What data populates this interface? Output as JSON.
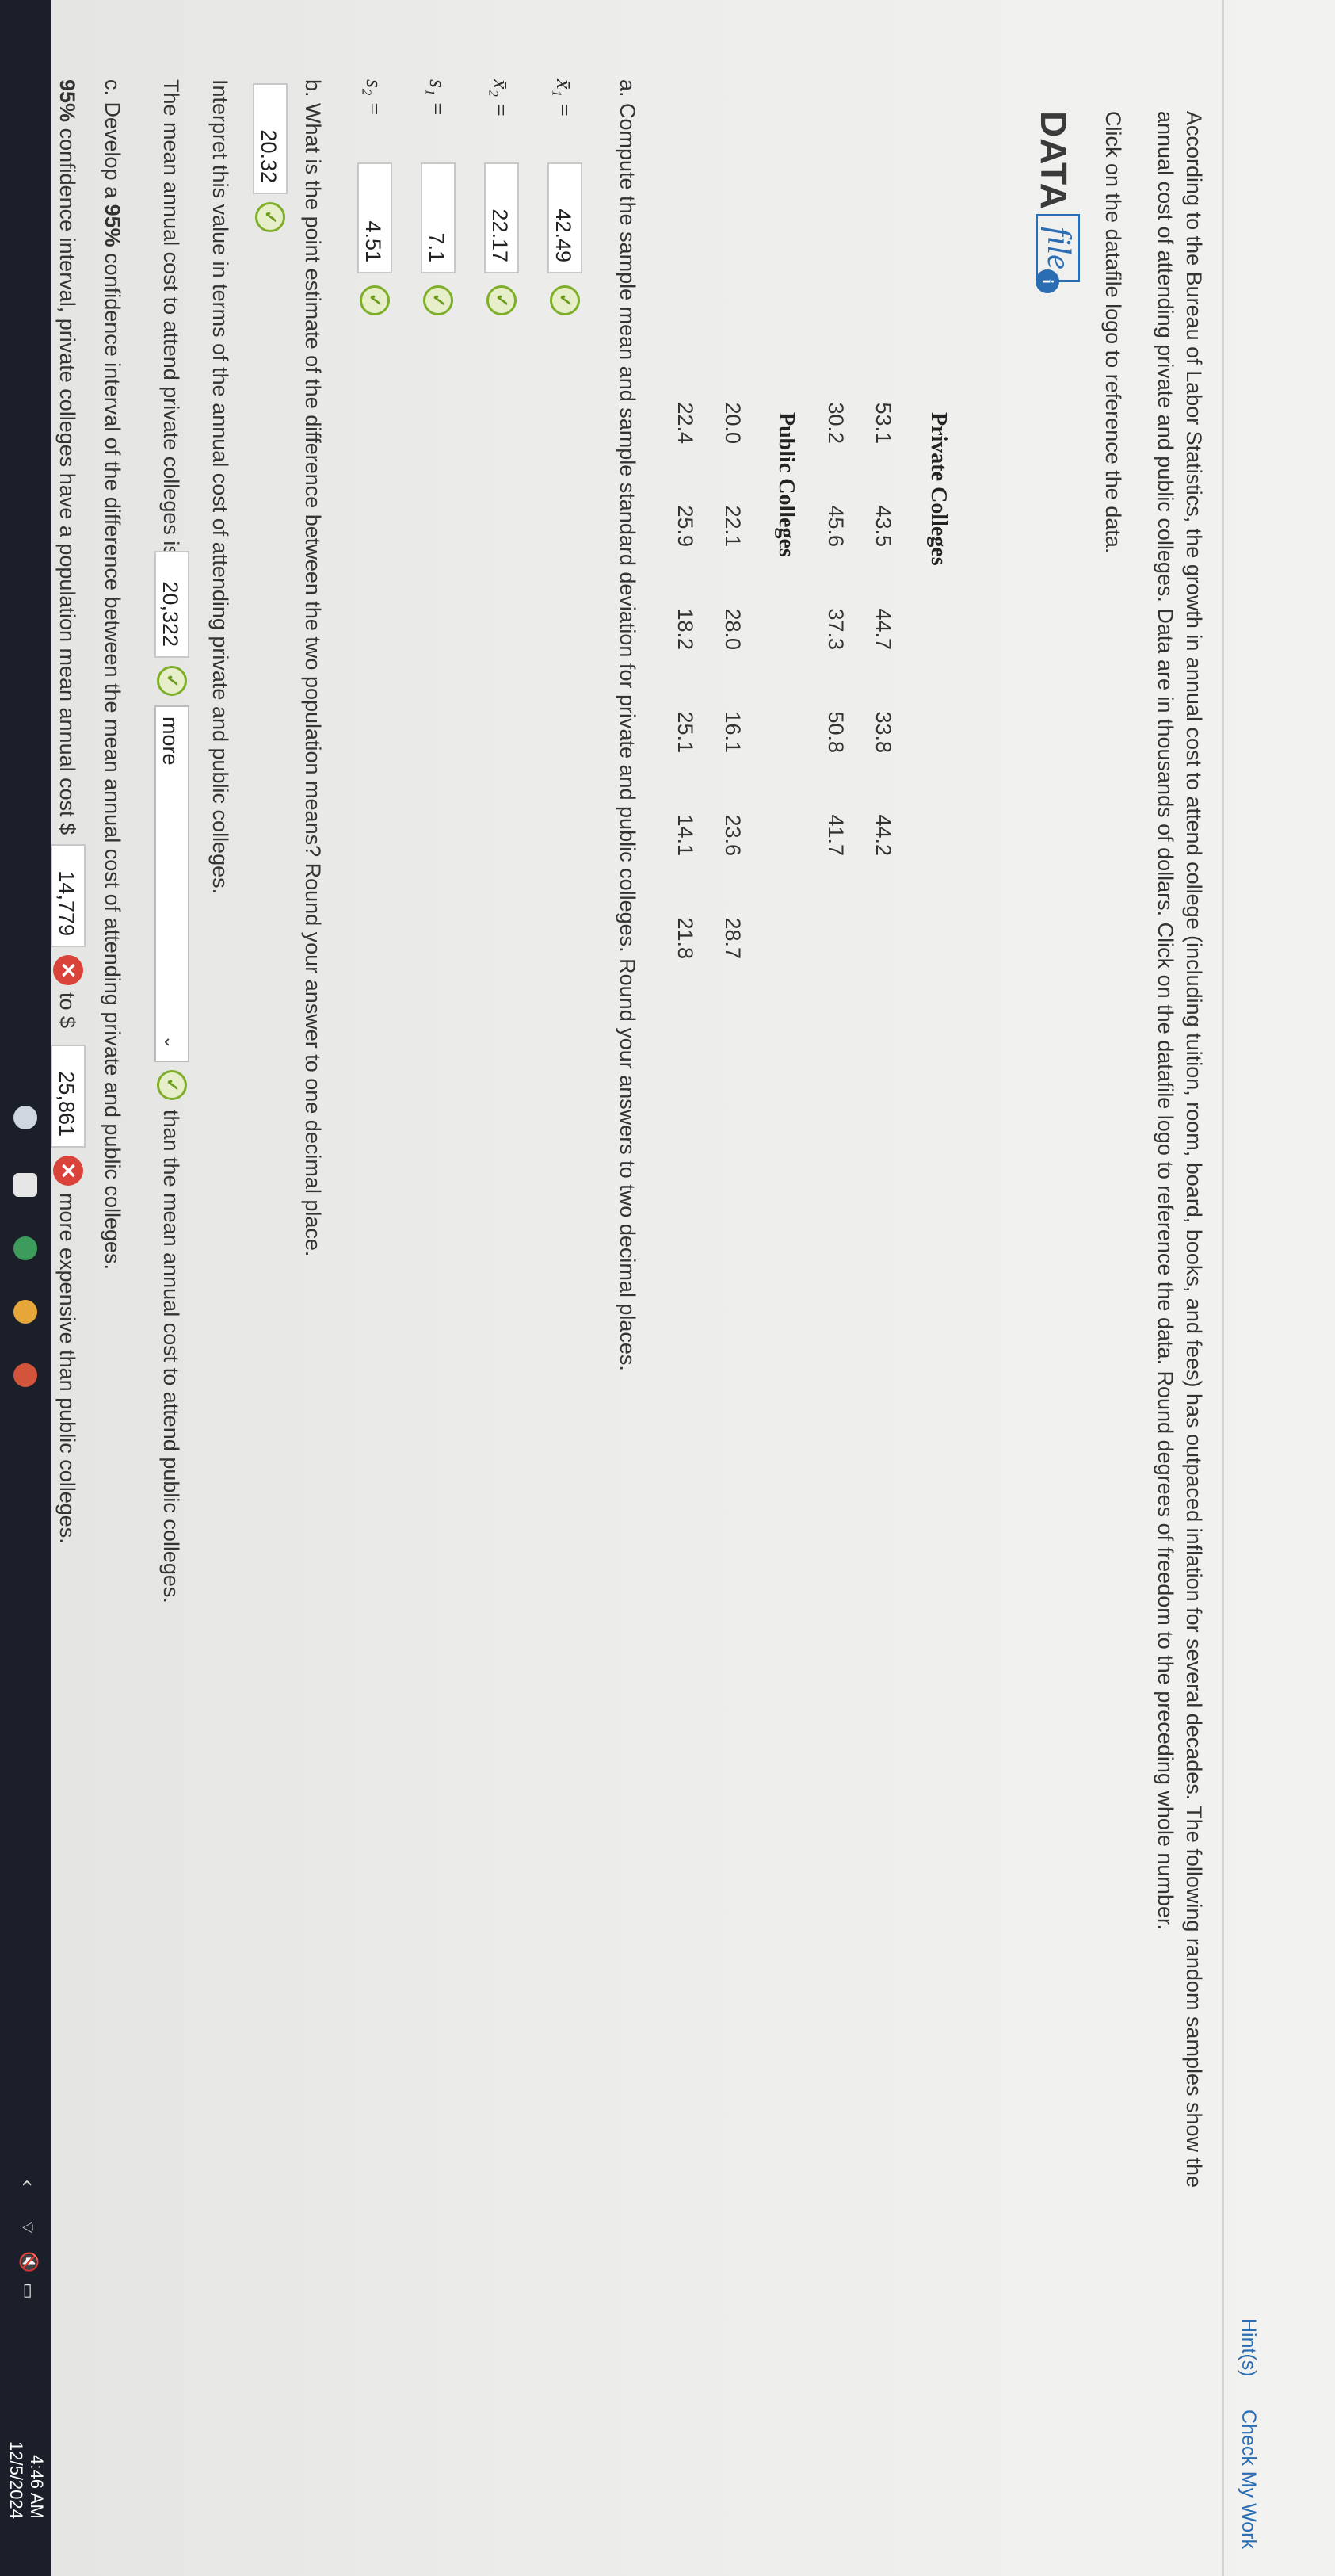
{
  "header": {
    "hints": "Hint(s)",
    "check": "Check My Work"
  },
  "intro": {
    "line1": "According to the Bureau of Labor Statistics, the growth in annual cost to attend college (including tuition, room, board, books, and fees) has outpaced inflation for several decades. The following random samples show the",
    "line2": "annual cost of attending private and public colleges. Data are in thousands of dollars. Click on the datafile logo to reference the data. Round degrees of freedom to the preceding whole number.",
    "click": "Click on the datafile logo to reference the data."
  },
  "datafile": {
    "word1": "DATA",
    "word2": "file"
  },
  "private": {
    "title": "Private Colleges",
    "row1": [
      "53.1",
      "43.5",
      "44.7",
      "33.8",
      "44.2"
    ],
    "row2": [
      "30.2",
      "45.6",
      "37.3",
      "50.8",
      "41.7"
    ]
  },
  "public": {
    "title": "Public Colleges",
    "row1": [
      "20.0",
      "22.1",
      "28.0",
      "16.1",
      "23.6",
      "28.7"
    ],
    "row2": [
      "22.4",
      "25.9",
      "18.2",
      "25.1",
      "14.1",
      "21.8"
    ]
  },
  "part_a": {
    "prompt": "a. Compute the sample mean and sample standard deviation for private and public colleges. Round your answers to two decimal places.",
    "x1_label": "x̄₁ =",
    "x1": "42.49",
    "x2_label": "x̄₂ =",
    "x2": "22.17",
    "s1_label": "s₁ =",
    "s1": "7.1",
    "s2_label": "s₂ =",
    "s2": "4.51"
  },
  "part_b": {
    "prompt": "b. What is the point estimate of the difference between the two population means? Round your answer to one decimal place.",
    "answer": "20.32",
    "interpret": "Interpret this value in terms of the annual cost of attending private and public colleges.",
    "line_pre": "The mean annual cost to attend private colleges is $",
    "amount": "20,322",
    "select": "more",
    "line_post": "than the mean annual cost to attend public colleges."
  },
  "part_c": {
    "prompt_pre": "c. Develop a",
    "prompt_bold": "95%",
    "prompt_post": "confidence interval of the difference between the mean annual cost of attending private and public colleges.",
    "line_bold": "95%",
    "line_pre": "confidence interval, private colleges have a population mean annual cost $",
    "low": "14,779",
    "to": "to $",
    "high": "25,861",
    "line_post": "more expensive than public colleges."
  },
  "icons": {
    "correct": "check-circle-icon",
    "incorrect": "x-circle-icon"
  },
  "colors": {
    "correct": "#7fae2a",
    "incorrect": "#d9433a",
    "link": "#2a6db3"
  },
  "taskbar": {
    "time": "4:46 AM",
    "date": "12/5/2024"
  }
}
